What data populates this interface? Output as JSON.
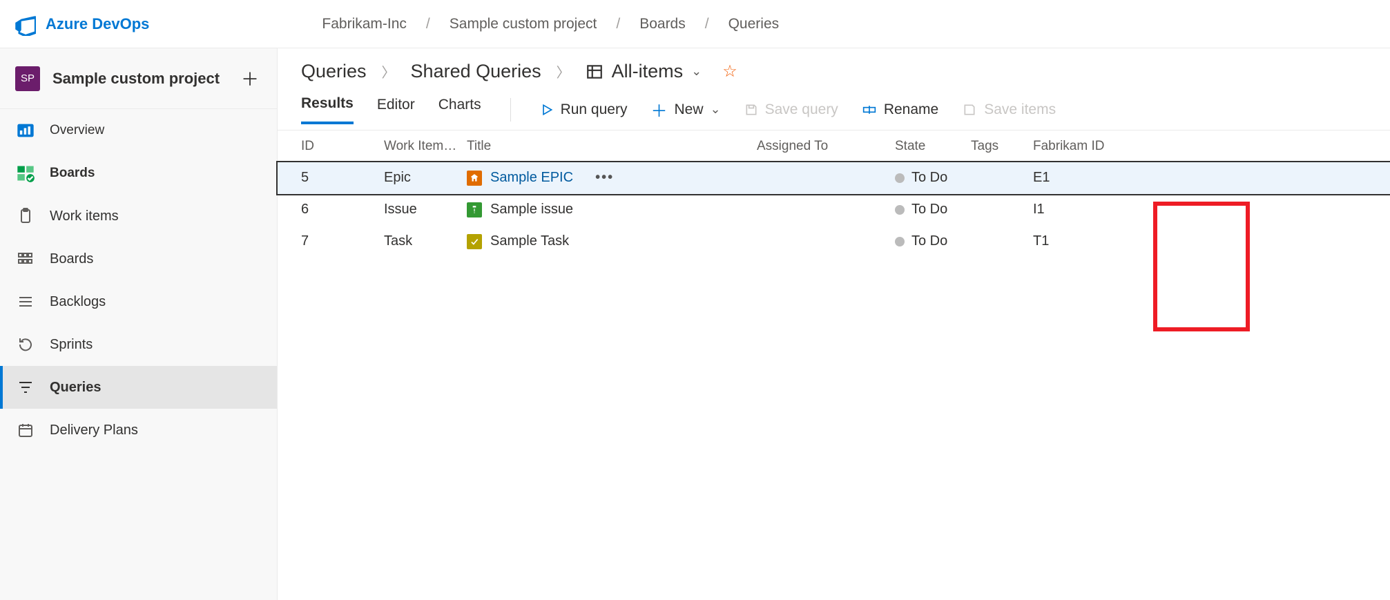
{
  "brand": "Azure DevOps",
  "breadcrumb_top": [
    "Fabrikam-Inc",
    "Sample custom project",
    "Boards",
    "Queries"
  ],
  "project": {
    "initials": "SP",
    "name": "Sample custom project"
  },
  "sidebar": {
    "overview": "Overview",
    "boards": "Boards",
    "children": {
      "work_items": "Work items",
      "boards": "Boards",
      "backlogs": "Backlogs",
      "sprints": "Sprints",
      "queries": "Queries",
      "delivery_plans": "Delivery Plans"
    }
  },
  "crumbs": {
    "a": "Queries",
    "b": "Shared Queries",
    "c": "All-items"
  },
  "tabs": {
    "results": "Results",
    "editor": "Editor",
    "charts": "Charts"
  },
  "toolbar": {
    "run": "Run query",
    "new": "New",
    "save_query": "Save query",
    "rename": "Rename",
    "save_items": "Save items"
  },
  "columns": {
    "id": "ID",
    "type": "Work Item…",
    "title": "Title",
    "assigned": "Assigned To",
    "state": "State",
    "tags": "Tags",
    "fabrikam": "Fabrikam ID"
  },
  "rows": [
    {
      "id": "5",
      "type": "Epic",
      "title": "Sample EPIC",
      "state": "To Do",
      "fabrikam": "E1",
      "selected": true,
      "kind": "epic"
    },
    {
      "id": "6",
      "type": "Issue",
      "title": "Sample issue",
      "state": "To Do",
      "fabrikam": "I1",
      "selected": false,
      "kind": "issue"
    },
    {
      "id": "7",
      "type": "Task",
      "title": "Sample Task",
      "state": "To Do",
      "fabrikam": "T1",
      "selected": false,
      "kind": "task"
    }
  ]
}
